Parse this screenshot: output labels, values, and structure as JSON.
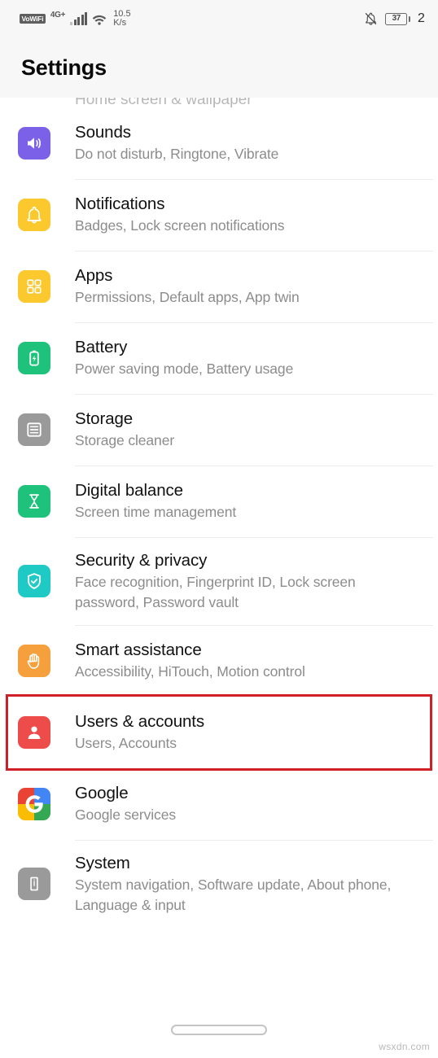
{
  "statusbar": {
    "vowifi_label": "VoWiFi",
    "network_generation": "4G+",
    "signal_icon": "signal-bars-icon",
    "wifi_icon": "wifi-icon",
    "network_speed_value": "10.5",
    "network_speed_unit": "K/s",
    "mute_icon": "bell-muted-icon",
    "battery_percent": "37",
    "clock_partial": "2"
  },
  "header": {
    "title": "Settings"
  },
  "list": {
    "partial_top_row_text": "Home screen & wallpaper",
    "items": [
      {
        "id": "sounds",
        "title": "Sounds",
        "subtitle": "Do not disturb, Ringtone, Vibrate",
        "icon": "speaker-volume-icon",
        "icon_color": "#7B61E8",
        "highlighted": false,
        "first": true
      },
      {
        "id": "notifications",
        "title": "Notifications",
        "subtitle": "Badges, Lock screen notifications",
        "icon": "bell-icon",
        "icon_color": "#FBC82E",
        "highlighted": false,
        "first": false
      },
      {
        "id": "apps",
        "title": "Apps",
        "subtitle": "Permissions, Default apps, App twin",
        "icon": "apps-grid-icon",
        "icon_color": "#FBC82E",
        "highlighted": false,
        "first": false
      },
      {
        "id": "battery",
        "title": "Battery",
        "subtitle": "Power saving mode, Battery usage",
        "icon": "battery-bolt-icon",
        "icon_color": "#1FC27A",
        "highlighted": false,
        "first": false
      },
      {
        "id": "storage",
        "title": "Storage",
        "subtitle": "Storage cleaner",
        "icon": "storage-drive-icon",
        "icon_color": "#9A9A9A",
        "highlighted": false,
        "first": false
      },
      {
        "id": "digital-balance",
        "title": "Digital balance",
        "subtitle": "Screen time management",
        "icon": "hourglass-icon",
        "icon_color": "#1FC27A",
        "highlighted": false,
        "first": false
      },
      {
        "id": "security-privacy",
        "title": "Security & privacy",
        "subtitle": "Face recognition, Fingerprint ID, Lock screen password, Password vault",
        "icon": "shield-check-icon",
        "icon_color": "#1FC9C4",
        "highlighted": false,
        "first": false
      },
      {
        "id": "smart-assistance",
        "title": "Smart assistance",
        "subtitle": "Accessibility, HiTouch, Motion control",
        "icon": "hand-icon",
        "icon_color": "#F5A03C",
        "highlighted": false,
        "first": false
      },
      {
        "id": "users-accounts",
        "title": "Users & accounts",
        "subtitle": "Users, Accounts",
        "icon": "user-person-icon",
        "icon_color": "#EE4B4B",
        "highlighted": true,
        "first": false
      },
      {
        "id": "google",
        "title": "Google",
        "subtitle": "Google services",
        "icon": "google-g-icon",
        "icon_color": "#4285F4",
        "highlighted": false,
        "first": false
      },
      {
        "id": "system",
        "title": "System",
        "subtitle": "System navigation, Software update, About phone, Language & input",
        "icon": "phone-info-icon",
        "icon_color": "#9A9A9A",
        "highlighted": false,
        "first": false
      }
    ]
  },
  "navigation": {
    "gesture_pill_label": "home-gesture-pill"
  },
  "watermark": {
    "text": "wsxdn.com"
  },
  "colors": {
    "highlight_border": "#cf2027",
    "statusbar_bg": "#f7f7f7",
    "page_bg": "#ffffff",
    "title_text": "#0a0a0a",
    "subtitle_text": "#8c8c8c",
    "separator": "#ececec"
  }
}
